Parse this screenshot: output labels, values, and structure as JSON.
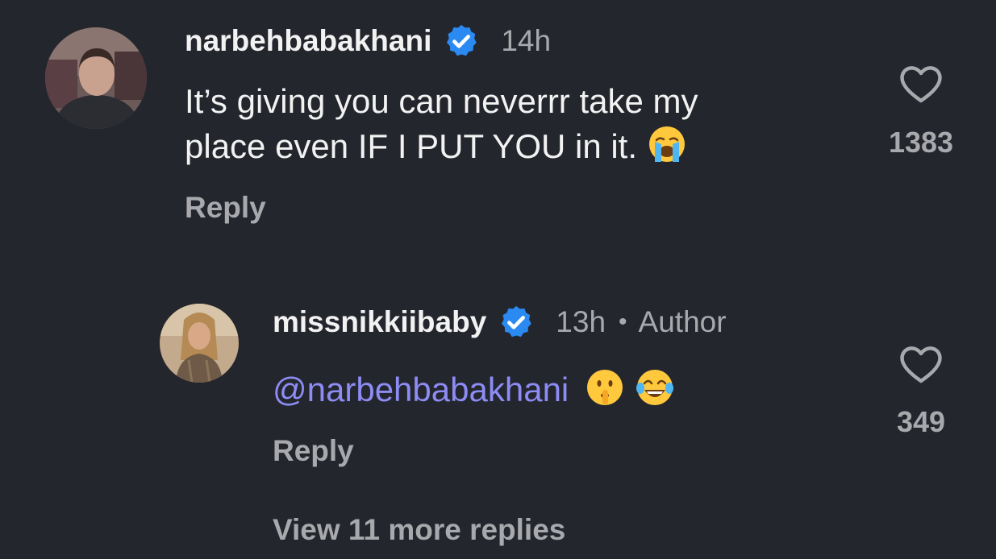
{
  "colors": {
    "background": "#24262d",
    "text_primary": "#f2f2f2",
    "text_secondary": "#a8a9ad",
    "mention": "#8d8cf4",
    "verified_badge": "#2a8af2"
  },
  "comments": [
    {
      "username": "narbehbabakhani",
      "verified": true,
      "time": "14h",
      "text_line1": "It’s giving you can neverrr take my",
      "text_line2": "place even IF I PUT YOU in it.",
      "emoji": "loudly-crying-face",
      "reply_label": "Reply",
      "like_icon": "heart-outline-icon",
      "like_count": "1383"
    },
    {
      "username": "missnikkiibaby",
      "verified": true,
      "time": "13h",
      "separator": "•",
      "badge": "Author",
      "mention": "@narbehbabakhani",
      "emojis": [
        "shushing-face",
        "face-with-tears-of-joy"
      ],
      "reply_label": "Reply",
      "like_icon": "heart-outline-icon",
      "like_count": "349"
    }
  ],
  "view_more_replies": "View 11 more replies"
}
